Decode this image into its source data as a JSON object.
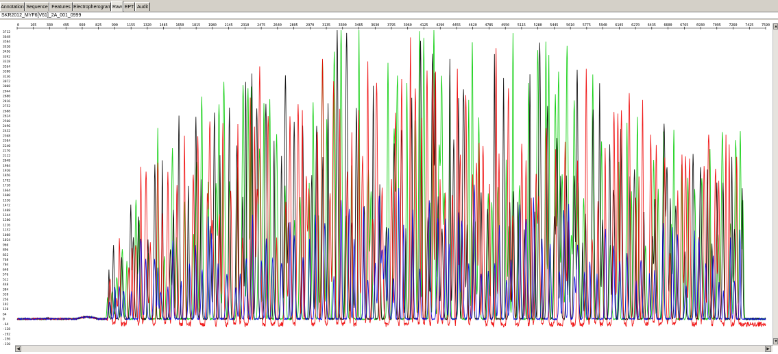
{
  "tabs": [
    "Annotation",
    "Sequence",
    "Features",
    "Electropherogram",
    "Raw",
    "EPT",
    "Audit"
  ],
  "active_tab": "Raw",
  "sample_name": "SKR2012_MYF6[V61]_2A_001_0999",
  "chart_data": {
    "type": "line",
    "x_tick_labels": [
      "0",
      "165",
      "330",
      "495",
      "660",
      "825",
      "990",
      "1155",
      "1320",
      "1485",
      "1650",
      "1815",
      "1980",
      "2145",
      "2310",
      "2475",
      "2640",
      "2805",
      "2970",
      "3135",
      "3300",
      "3465",
      "3630",
      "3795",
      "3960",
      "4125",
      "4290",
      "4455",
      "4620",
      "4785",
      "4950",
      "5115",
      "5280",
      "5445",
      "5610",
      "5775",
      "5940",
      "6105",
      "6270",
      "6435",
      "6600",
      "6765",
      "6930",
      "7095",
      "7260",
      "7425",
      "7590"
    ],
    "y_tick_labels": [
      "3712",
      "3648",
      "3584",
      "3520",
      "3456",
      "3392",
      "3328",
      "3264",
      "3200",
      "3136",
      "3072",
      "3008",
      "2944",
      "2880",
      "2816",
      "2752",
      "2688",
      "2624",
      "2560",
      "2496",
      "2432",
      "2368",
      "2304",
      "2240",
      "2176",
      "2112",
      "2048",
      "1984",
      "1920",
      "1856",
      "1792",
      "1728",
      "1664",
      "1600",
      "1536",
      "1472",
      "1408",
      "1344",
      "1280",
      "1216",
      "1152",
      "1088",
      "1024",
      "960",
      "896",
      "832",
      "768",
      "704",
      "640",
      "576",
      "512",
      "448",
      "384",
      "320",
      "256",
      "192",
      "128",
      "64",
      "0",
      "-64",
      "-128",
      "-192",
      "-256",
      "-320"
    ],
    "xlim": [
      0,
      7590
    ],
    "ylim": [
      -320,
      3712
    ],
    "series_colors": [
      "#00cc00",
      "#000000",
      "#ee0000",
      "#0000dd"
    ],
    "grid": false
  },
  "icons": {
    "scroll_up": "▲",
    "scroll_down": "▼",
    "scroll_left": "◀",
    "scroll_right": "▶"
  }
}
